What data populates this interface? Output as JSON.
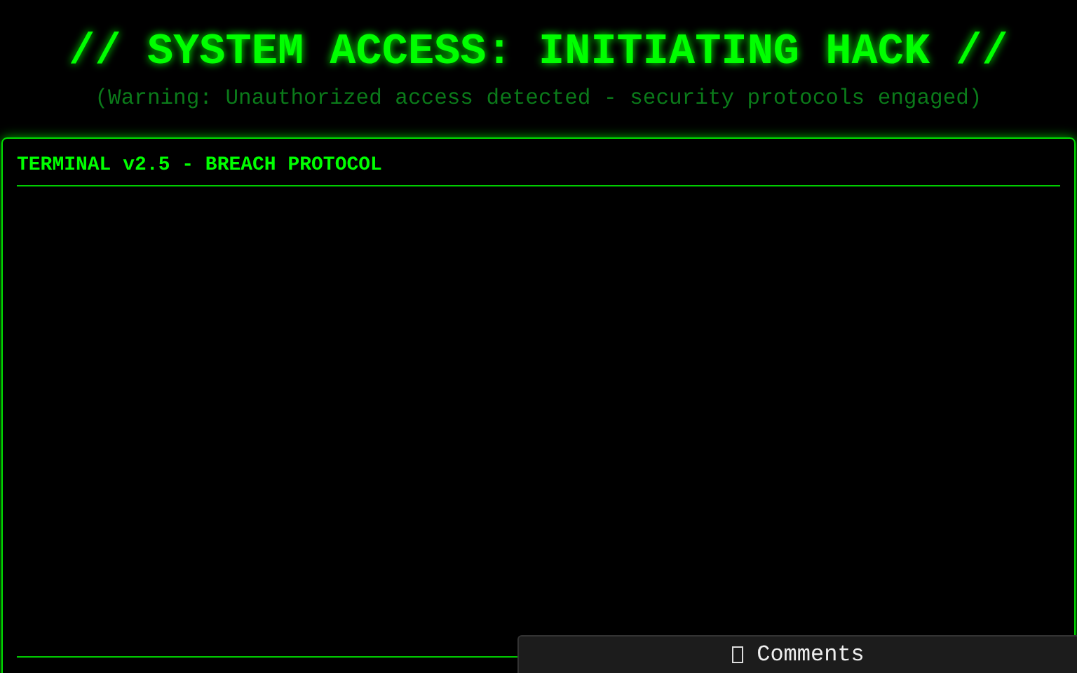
{
  "header": {
    "title": "// SYSTEM ACCESS: INITIATING HACK //",
    "subtitle": "(Warning: Unauthorized access detected - security protocols engaged)"
  },
  "terminal": {
    "title": "TERMINAL v2.5 - BREACH PROTOCOL"
  },
  "comments_button": {
    "label": "Comments"
  }
}
